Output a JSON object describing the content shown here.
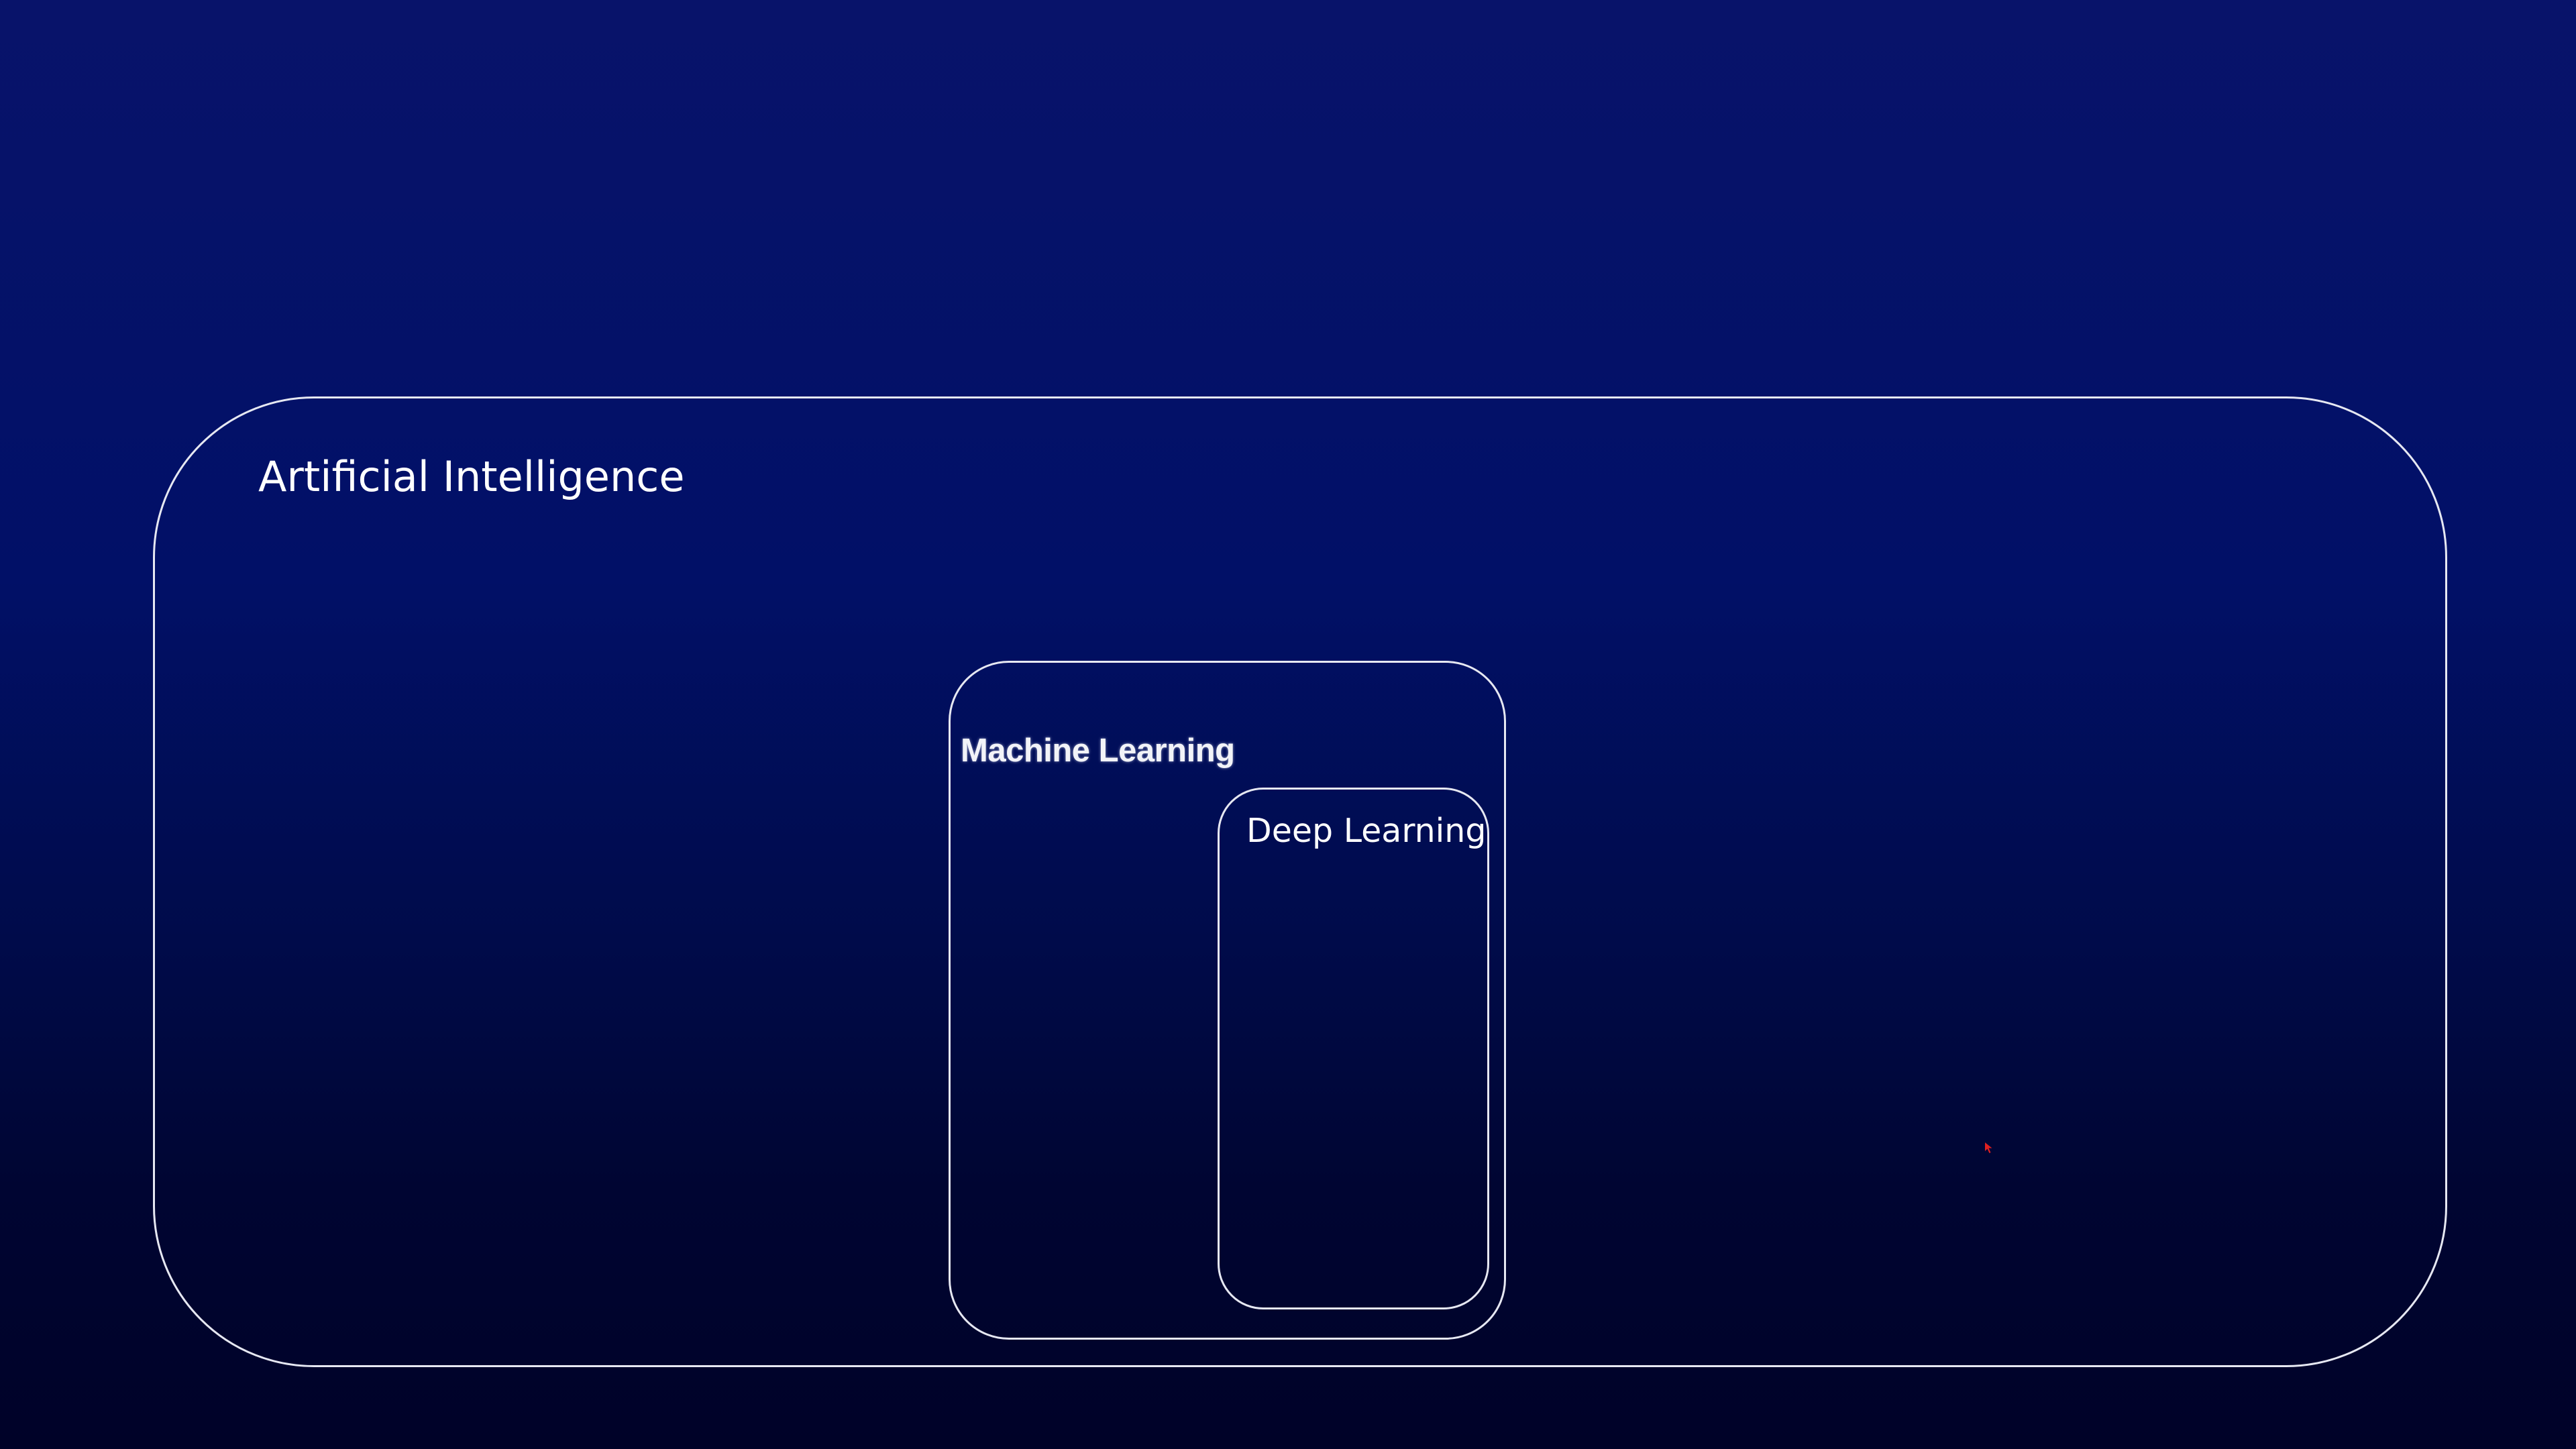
{
  "diagram": {
    "outer": {
      "label": "Artificial Intelligence"
    },
    "middle": {
      "label": "Machine Learning"
    },
    "inner": {
      "label": "Deep Learning"
    }
  },
  "colors": {
    "background_top": "#08136a",
    "background_bottom": "#000228",
    "outline": "#e6e8f2",
    "text": "#ffffff",
    "cursor": "#e02020"
  },
  "icons": {
    "cursor": "mouse-pointer-icon"
  }
}
